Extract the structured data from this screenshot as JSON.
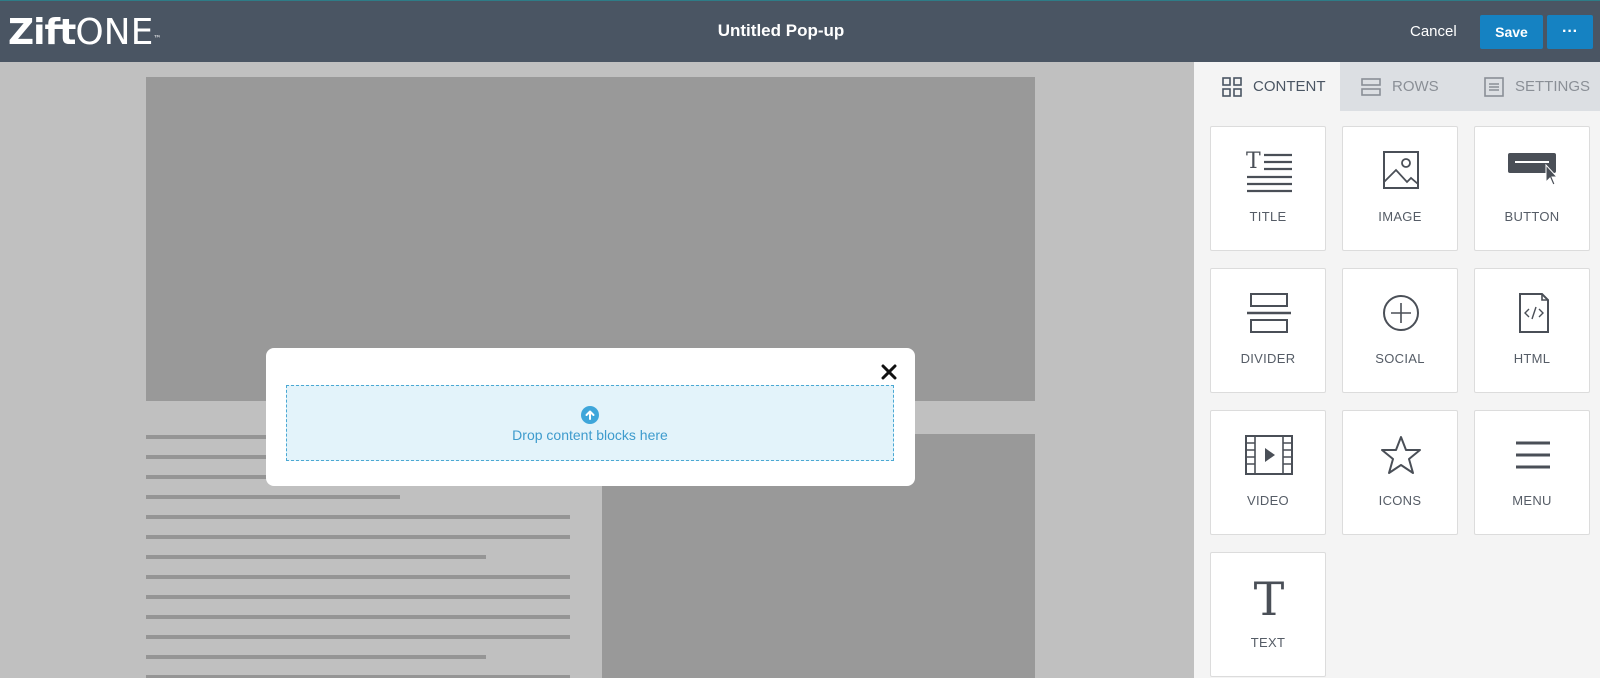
{
  "header": {
    "logo_bold": "Zift",
    "logo_light": "ONE",
    "logo_tm": "™",
    "title": "Untitled Pop-up",
    "cancel_label": "Cancel",
    "save_label": "Save",
    "more_label": "···"
  },
  "popup": {
    "drop_message": "Drop content blocks here"
  },
  "panel": {
    "tabs": [
      {
        "label": "CONTENT",
        "icon": "grid-icon",
        "active": true
      },
      {
        "label": "ROWS",
        "icon": "rows-icon",
        "active": false
      },
      {
        "label": "SETTINGS",
        "icon": "settings-icon",
        "active": false
      }
    ],
    "blocks": [
      {
        "label": "TITLE",
        "icon": "title-icon"
      },
      {
        "label": "IMAGE",
        "icon": "image-icon"
      },
      {
        "label": "BUTTON",
        "icon": "button-icon"
      },
      {
        "label": "DIVIDER",
        "icon": "divider-icon"
      },
      {
        "label": "SOCIAL",
        "icon": "social-plus-icon"
      },
      {
        "label": "HTML",
        "icon": "html-file-icon"
      },
      {
        "label": "VIDEO",
        "icon": "video-icon"
      },
      {
        "label": "ICONS",
        "icon": "star-icon"
      },
      {
        "label": "MENU",
        "icon": "menu-icon"
      },
      {
        "label": "TEXT",
        "icon": "text-icon"
      }
    ]
  },
  "colors": {
    "topbar": "#4a5563",
    "accent": "#1582c2",
    "dropzone_bg": "#e3f3fa",
    "dropzone_text": "#3e9bcd"
  }
}
